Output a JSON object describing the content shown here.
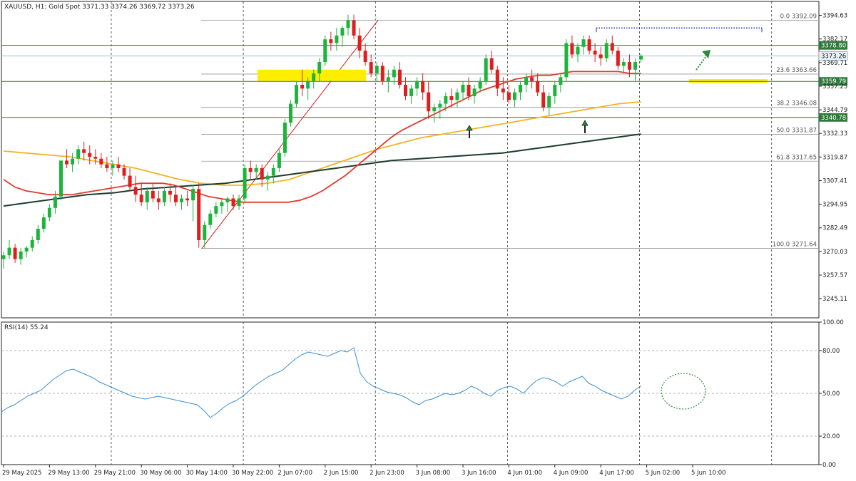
{
  "header": {
    "symbol_label": "XAUUSD, H1:  Gold Spot  3371.33 3374.26 3369.72 3373.26"
  },
  "rsi_header": {
    "label": "RSI(14) 55.24"
  },
  "colors": {
    "bull": "#1db43c",
    "bear": "#e01e1e",
    "ema50": "#e23a2e",
    "ema100": "#f5b322",
    "ema200": "#1d3d2d",
    "rsi": "#3a8fd6",
    "level": "#2d7a3a",
    "zone": "#ffee00",
    "arrow": "#2d8a3a",
    "fib": "#999999",
    "trend": "#d61c1c",
    "resistance": "#1f2fd6",
    "current_price": "#e8f2f5"
  },
  "chart_data": [
    {
      "type": "candlestick",
      "title": "XAUUSD, H1:  Gold Spot",
      "ohlc_header": {
        "open": 3371.33,
        "high": 3374.26,
        "low": 3369.72,
        "close": 3373.26
      },
      "ylim": [
        3235,
        3402
      ],
      "price_ticks": [
        3394.63,
        3382.17,
        3369.71,
        3357.25,
        3344.79,
        3332.33,
        3319.87,
        3307.41,
        3294.95,
        3282.49,
        3270.03,
        3257.57,
        3245.11
      ],
      "price_tick_labels": [
        "3394.63",
        "3382.17",
        "3369.71",
        "3357.25",
        "3344.79",
        "3332.33",
        "3319.87",
        "3307.41",
        "3294.95",
        "3282.49",
        "3270.03",
        "3257.57",
        "3245.11"
      ],
      "time_labels": [
        "29 May 2025",
        "29 May 13:00",
        "29 May 21:00",
        "30 May 06:00",
        "30 May 14:00",
        "30 May 22:00",
        "2 Jun 07:00",
        "2 Jun 15:00",
        "2 Jun 23:00",
        "3 Jun 08:00",
        "3 Jun 16:00",
        "4 Jun 01:00",
        "4 Jun 09:00",
        "4 Jun 17:00",
        "5 Jun 02:00",
        "5 Jun 10:00"
      ],
      "time_label_candle_index": [
        0,
        8,
        16,
        24,
        32,
        40,
        48,
        56,
        64,
        72,
        80,
        88,
        96,
        104,
        112,
        120
      ],
      "vertical_grid_candle_index": [
        19,
        42,
        65,
        88,
        111,
        134
      ],
      "candles": [
        [
          3266,
          3270,
          3261,
          3268
        ],
        [
          3268,
          3276,
          3266,
          3272
        ],
        [
          3272,
          3274,
          3264,
          3266
        ],
        [
          3266,
          3272,
          3263,
          3270
        ],
        [
          3270,
          3273,
          3267,
          3272
        ],
        [
          3272,
          3278,
          3270,
          3276
        ],
        [
          3276,
          3284,
          3274,
          3282
        ],
        [
          3282,
          3290,
          3280,
          3288
        ],
        [
          3288,
          3295,
          3286,
          3293
        ],
        [
          3293,
          3302,
          3290,
          3299
        ],
        [
          3299,
          3310,
          3297,
          3318
        ],
        [
          3318,
          3324,
          3314,
          3316
        ],
        [
          3316,
          3322,
          3312,
          3319
        ],
        [
          3319,
          3326,
          3316,
          3324
        ],
        [
          3324,
          3328,
          3318,
          3322
        ],
        [
          3322,
          3326,
          3316,
          3320
        ],
        [
          3320,
          3324,
          3316,
          3319
        ],
        [
          3319,
          3322,
          3314,
          3316
        ],
        [
          3316,
          3320,
          3312,
          3314
        ],
        [
          3314,
          3318,
          3310,
          3316
        ],
        [
          3316,
          3320,
          3312,
          3314
        ],
        [
          3314,
          3316,
          3308,
          3310
        ],
        [
          3310,
          3314,
          3302,
          3304
        ],
        [
          3304,
          3310,
          3296,
          3300
        ],
        [
          3300,
          3306,
          3294,
          3296
        ],
        [
          3296,
          3304,
          3292,
          3302
        ],
        [
          3302,
          3306,
          3296,
          3298
        ],
        [
          3298,
          3302,
          3292,
          3296
        ],
        [
          3296,
          3304,
          3294,
          3302
        ],
        [
          3302,
          3306,
          3296,
          3300
        ],
        [
          3300,
          3304,
          3294,
          3296
        ],
        [
          3296,
          3300,
          3292,
          3298
        ],
        [
          3298,
          3302,
          3294,
          3297
        ],
        [
          3297,
          3305,
          3286,
          3303
        ],
        [
          3303,
          3306,
          3272,
          3276
        ],
        [
          3276,
          3286,
          3272,
          3284
        ],
        [
          3284,
          3292,
          3282,
          3290
        ],
        [
          3290,
          3296,
          3288,
          3294
        ],
        [
          3294,
          3298,
          3290,
          3296
        ],
        [
          3296,
          3299,
          3291,
          3298
        ],
        [
          3298,
          3300,
          3292,
          3294
        ],
        [
          3294,
          3300,
          3292,
          3298
        ],
        [
          3298,
          3316,
          3296,
          3314
        ],
        [
          3314,
          3318,
          3308,
          3312
        ],
        [
          3312,
          3316,
          3308,
          3314
        ],
        [
          3314,
          3316,
          3304,
          3308
        ],
        [
          3308,
          3312,
          3302,
          3310
        ],
        [
          3310,
          3316,
          3306,
          3314
        ],
        [
          3314,
          3324,
          3312,
          3322
        ],
        [
          3322,
          3340,
          3320,
          3338
        ],
        [
          3338,
          3350,
          3336,
          3348
        ],
        [
          3348,
          3360,
          3346,
          3358
        ],
        [
          3358,
          3366,
          3352,
          3356
        ],
        [
          3356,
          3362,
          3350,
          3360
        ],
        [
          3360,
          3366,
          3356,
          3364
        ],
        [
          3364,
          3372,
          3360,
          3370
        ],
        [
          3370,
          3384,
          3368,
          3382
        ],
        [
          3382,
          3386,
          3376,
          3380
        ],
        [
          3380,
          3388,
          3376,
          3384
        ],
        [
          3384,
          3389,
          3378,
          3388
        ],
        [
          3388,
          3395,
          3384,
          3392
        ],
        [
          3392,
          3395,
          3382,
          3384
        ],
        [
          3384,
          3388,
          3372,
          3376
        ],
        [
          3376,
          3380,
          3368,
          3370
        ],
        [
          3370,
          3374,
          3362,
          3364
        ],
        [
          3364,
          3370,
          3360,
          3368
        ],
        [
          3368,
          3370,
          3358,
          3360
        ],
        [
          3360,
          3366,
          3354,
          3362
        ],
        [
          3362,
          3368,
          3358,
          3366
        ],
        [
          3366,
          3370,
          3356,
          3358
        ],
        [
          3358,
          3362,
          3350,
          3352
        ],
        [
          3352,
          3358,
          3348,
          3356
        ],
        [
          3356,
          3362,
          3352,
          3360
        ],
        [
          3360,
          3364,
          3350,
          3354
        ],
        [
          3354,
          3360,
          3340,
          3344
        ],
        [
          3344,
          3348,
          3338,
          3346
        ],
        [
          3346,
          3350,
          3340,
          3348
        ],
        [
          3348,
          3354,
          3344,
          3352
        ],
        [
          3352,
          3356,
          3346,
          3350
        ],
        [
          3350,
          3356,
          3346,
          3354
        ],
        [
          3354,
          3360,
          3350,
          3358
        ],
        [
          3358,
          3362,
          3350,
          3352
        ],
        [
          3352,
          3358,
          3348,
          3356
        ],
        [
          3356,
          3362,
          3354,
          3360
        ],
        [
          3360,
          3374,
          3358,
          3372
        ],
        [
          3372,
          3376,
          3364,
          3366
        ],
        [
          3366,
          3368,
          3352,
          3356
        ],
        [
          3356,
          3362,
          3350,
          3354
        ],
        [
          3354,
          3358,
          3348,
          3350
        ],
        [
          3350,
          3356,
          3346,
          3354
        ],
        [
          3354,
          3360,
          3350,
          3358
        ],
        [
          3358,
          3364,
          3354,
          3362
        ],
        [
          3362,
          3366,
          3356,
          3360
        ],
        [
          3360,
          3364,
          3352,
          3354
        ],
        [
          3354,
          3358,
          3344,
          3346
        ],
        [
          3346,
          3354,
          3342,
          3352
        ],
        [
          3352,
          3360,
          3348,
          3358
        ],
        [
          3358,
          3364,
          3354,
          3362
        ],
        [
          3362,
          3382,
          3360,
          3380
        ],
        [
          3380,
          3384,
          3372,
          3374
        ],
        [
          3374,
          3380,
          3370,
          3378
        ],
        [
          3378,
          3384,
          3374,
          3382
        ],
        [
          3382,
          3384,
          3374,
          3376
        ],
        [
          3376,
          3380,
          3370,
          3374
        ],
        [
          3374,
          3378,
          3368,
          3372
        ],
        [
          3372,
          3382,
          3370,
          3380
        ],
        [
          3380,
          3384,
          3374,
          3376
        ],
        [
          3376,
          3378,
          3366,
          3368
        ],
        [
          3368,
          3372,
          3364,
          3370
        ],
        [
          3370,
          3374,
          3362,
          3366
        ],
        [
          3366,
          3372,
          3360,
          3370
        ],
        [
          3371.33,
          3374.26,
          3369.72,
          3373.26
        ]
      ],
      "ema50": [
        3308,
        3304,
        3302,
        3301,
        3300,
        3300,
        3300,
        3301,
        3302,
        3303,
        3304,
        3305,
        3306,
        3306,
        3306,
        3305,
        3303,
        3301,
        3299,
        3298,
        3297,
        3296,
        3296,
        3296,
        3296,
        3296,
        3297,
        3299,
        3302,
        3306,
        3310,
        3315,
        3320,
        3325,
        3330,
        3334,
        3337,
        3340,
        3343,
        3346,
        3349,
        3352,
        3355,
        3357,
        3359,
        3361,
        3362,
        3363,
        3363,
        3364,
        3365,
        3365,
        3365,
        3365,
        3365,
        3364,
        3364
      ],
      "ema50_start_candle": 0,
      "ema100": [
        3323,
        3322,
        3321,
        3320,
        3318,
        3316,
        3314,
        3311,
        3308,
        3306,
        3305,
        3305,
        3306,
        3308,
        3312,
        3316,
        3320,
        3324,
        3327,
        3330,
        3332,
        3334,
        3336,
        3338,
        3340,
        3342,
        3344,
        3346,
        3348,
        3349
      ],
      "ema100_start_candle": 0,
      "ema200": [
        3294,
        3296,
        3298,
        3300,
        3301,
        3303,
        3304,
        3305,
        3306,
        3308,
        3310,
        3312,
        3314,
        3316,
        3318,
        3319,
        3320,
        3321,
        3322,
        3324,
        3326,
        3328,
        3330,
        3332
      ],
      "ema200_start_candle": 0,
      "horizontal_levels": [
        {
          "price": 3378.8,
          "label": "3378.80"
        },
        {
          "price": 3359.79,
          "label": "3359.79"
        },
        {
          "price": 3340.78,
          "label": "3340.78"
        }
      ],
      "current_price": {
        "price": 3373.26,
        "label": "3373.26"
      },
      "resistance_line_price": 3388,
      "fibonacci": [
        {
          "level": 0.0,
          "price": 3392.09,
          "label": "0.0 3392.09"
        },
        {
          "level": 23.6,
          "price": 3363.66,
          "label": "23.6 3363.66"
        },
        {
          "level": 38.2,
          "price": 3346.08,
          "label": "38.2 3346.08"
        },
        {
          "level": 50.0,
          "price": 3331.87,
          "label": "50.0 3331.87"
        },
        {
          "level": 61.8,
          "price": 3317.65,
          "label": "61.8 3317.65"
        },
        {
          "level": 100.0,
          "price": 3271.64,
          "label": "100.0 3271.64"
        }
      ],
      "trendline": {
        "from_price": 3271.64,
        "to_price": 3392.09
      },
      "zones": [
        {
          "price_top": 3366,
          "price_bottom": 3360
        },
        {
          "price_top": 3361,
          "price_bottom": 3359
        }
      ]
    },
    {
      "type": "line",
      "title": "RSI(14) 55.24",
      "ylim": [
        0,
        100
      ],
      "ticks": [
        100.0,
        80.0,
        50.0,
        20.0,
        0.0
      ],
      "tick_labels": [
        "100.00",
        "80.00",
        "50.00",
        "20.00",
        "0.00"
      ],
      "guide_levels": [
        80,
        50,
        20
      ],
      "values": [
        37,
        40,
        42,
        45,
        48,
        50,
        52,
        56,
        60,
        63,
        66,
        67,
        65,
        63,
        61,
        58,
        56,
        54,
        52,
        50,
        48,
        47,
        46,
        47,
        48,
        47,
        46,
        45,
        44,
        43,
        42,
        38,
        33,
        36,
        40,
        43,
        45,
        48,
        52,
        56,
        59,
        62,
        64,
        66,
        70,
        74,
        77,
        79,
        78,
        77,
        76,
        78,
        80,
        79,
        82,
        64,
        58,
        55,
        53,
        51,
        50,
        49,
        47,
        44,
        42,
        45,
        46,
        48,
        50,
        49,
        50,
        52,
        55,
        53,
        50,
        48,
        52,
        54,
        55,
        53,
        50,
        55,
        59,
        61,
        60,
        58,
        55,
        58,
        60,
        62,
        57,
        55,
        52,
        50,
        48,
        46,
        48,
        52,
        55.24
      ]
    }
  ]
}
